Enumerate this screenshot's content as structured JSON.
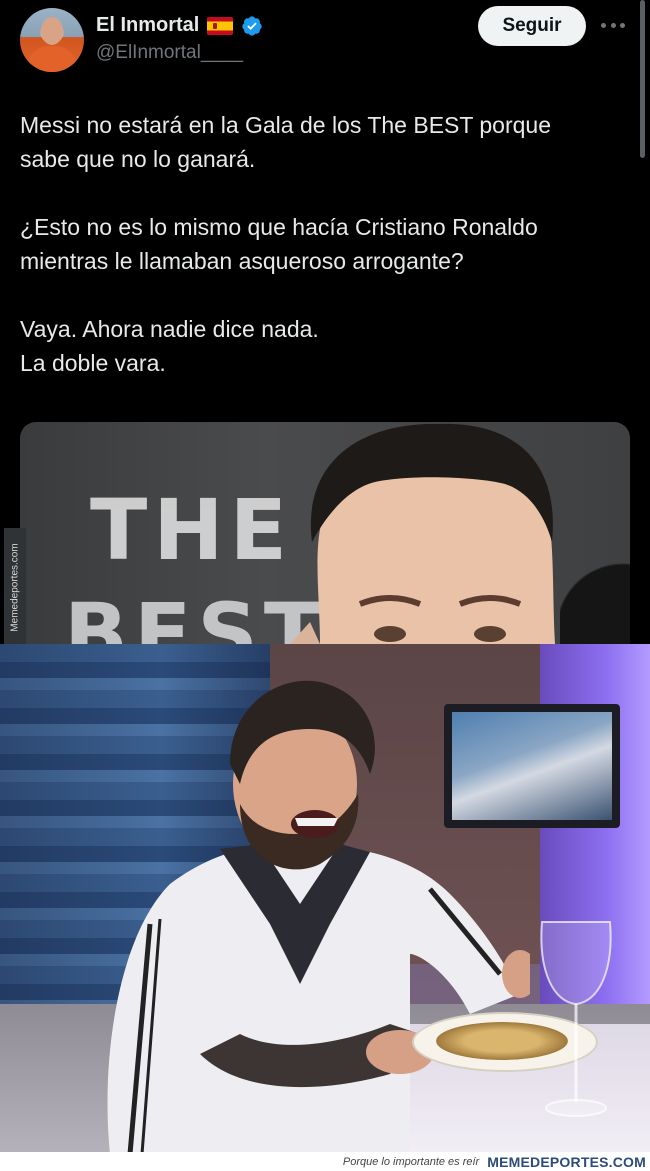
{
  "tweet": {
    "author": {
      "display_name": "El Inmortal",
      "handle": "@ElInmortal____",
      "flag": "spain-flag-icon",
      "verified": true
    },
    "follow_label": "Seguir",
    "text_paragraphs": [
      [
        "Messi no estará en la Gala de los The BEST porque",
        "sabe que no lo ganará."
      ],
      [
        "¿Esto no es lo mismo que hacía Cristiano Ronaldo",
        "mientras le llamaban asqueroso arrogante?"
      ],
      [
        "Vaya. Ahora nadie dice nada.",
        "La doble vara."
      ]
    ],
    "media_logo_text": [
      "THE",
      "BEST"
    ]
  },
  "watermark": {
    "side_text": "Memedeportes.com"
  },
  "footer": {
    "tagline": "Porque lo importante es reír",
    "brand": "MEMEDEPORTES.COM"
  },
  "colors": {
    "background": "#000000",
    "text": "#e7e9ea",
    "muted": "#71767b",
    "verified": "#1d9bf0",
    "follow_bg": "#eff3f4"
  }
}
